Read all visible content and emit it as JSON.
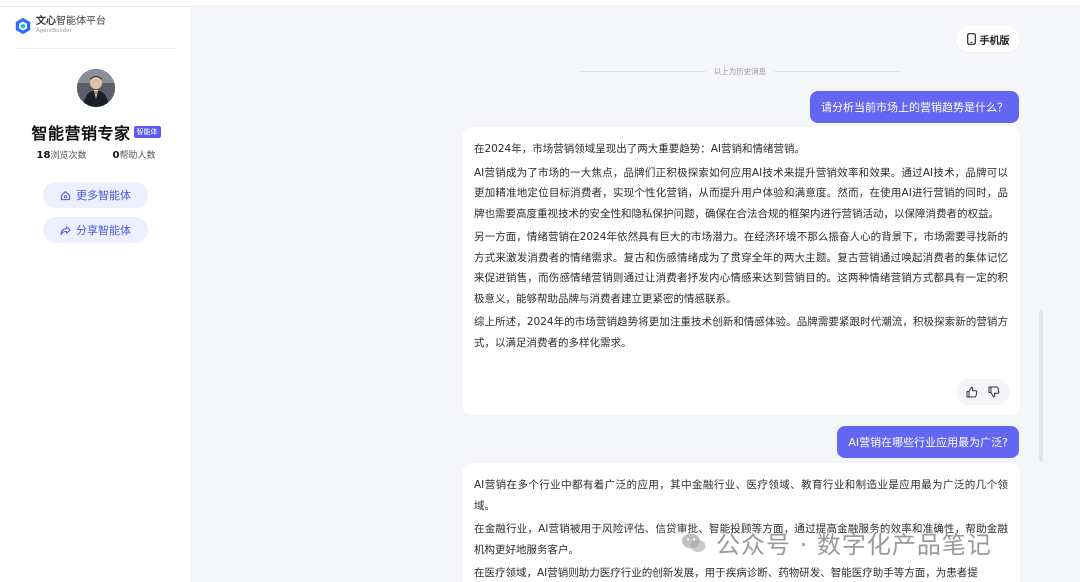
{
  "brand": {
    "name_cn": "文心",
    "name_sub": "智能体平台",
    "name_en": "AgentBuilder"
  },
  "agent": {
    "name": "智能营销专家",
    "badge": "智能体"
  },
  "stats": [
    {
      "value": "18",
      "label": "浏览次数"
    },
    {
      "value": "0",
      "label": "帮助人数"
    }
  ],
  "sidebar_buttons": {
    "more": "更多智能体",
    "share": "分享智能体"
  },
  "header": {
    "mobile_label": "手机版"
  },
  "history_divider": "以上为历史消息",
  "messages": [
    {
      "role": "user",
      "text": "请分析当前市场上的营销趋势是什么？"
    },
    {
      "role": "ai",
      "paragraphs": [
        "在2024年，市场营销领域呈现出了两大重要趋势：AI营销和情绪营销。",
        "AI营销成为了市场的一大焦点，品牌们正积极探索如何应用AI技术来提升营销效率和效果。通过AI技术，品牌可以更加精准地定位目标消费者，实现个性化营销，从而提升用户体验和满意度。然而，在使用AI进行营销的同时，品牌也需要高度重视技术的安全性和隐私保护问题，确保在合法合规的框架内进行营销活动，以保障消费者的权益。",
        "另一方面，情绪营销在2024年依然具有巨大的市场潜力。在经济环境不那么振奋人心的背景下，市场需要寻找新的方式来激发消费者的情绪需求。复古和伤感情绪成为了贯穿全年的两大主题。复古营销通过唤起消费者的集体记忆来促进销售，而伤感情绪营销则通过让消费者抒发内心情感来达到营销目的。这两种情绪营销方式都具有一定的积极意义，能够帮助品牌与消费者建立更紧密的情感联系。",
        "综上所述，2024年的市场营销趋势将更加注重技术创新和情感体验。品牌需要紧跟时代潮流，积极探索新的营销方式，以满足消费者的多样化需求。"
      ]
    },
    {
      "role": "user",
      "text": "AI营销在哪些行业应用最为广泛?"
    },
    {
      "role": "ai",
      "paragraphs": [
        "AI营销在多个行业中都有着广泛的应用，其中金融行业、医疗领域、教育行业和制造业是应用最为广泛的几个领域。",
        "在金融行业，AI营销被用于风险评估、信贷审批、智能投顾等方面，通过提高金融服务的效率和准确性，帮助金融机构更好地服务客户。",
        "在医疗领域，AI营销则助力医疗行业的创新发展，用于疾病诊断、药物研发、智能医疗助手等方面，为患者提"
      ]
    }
  ],
  "watermark": "公众号 · 数字化产品笔记"
}
